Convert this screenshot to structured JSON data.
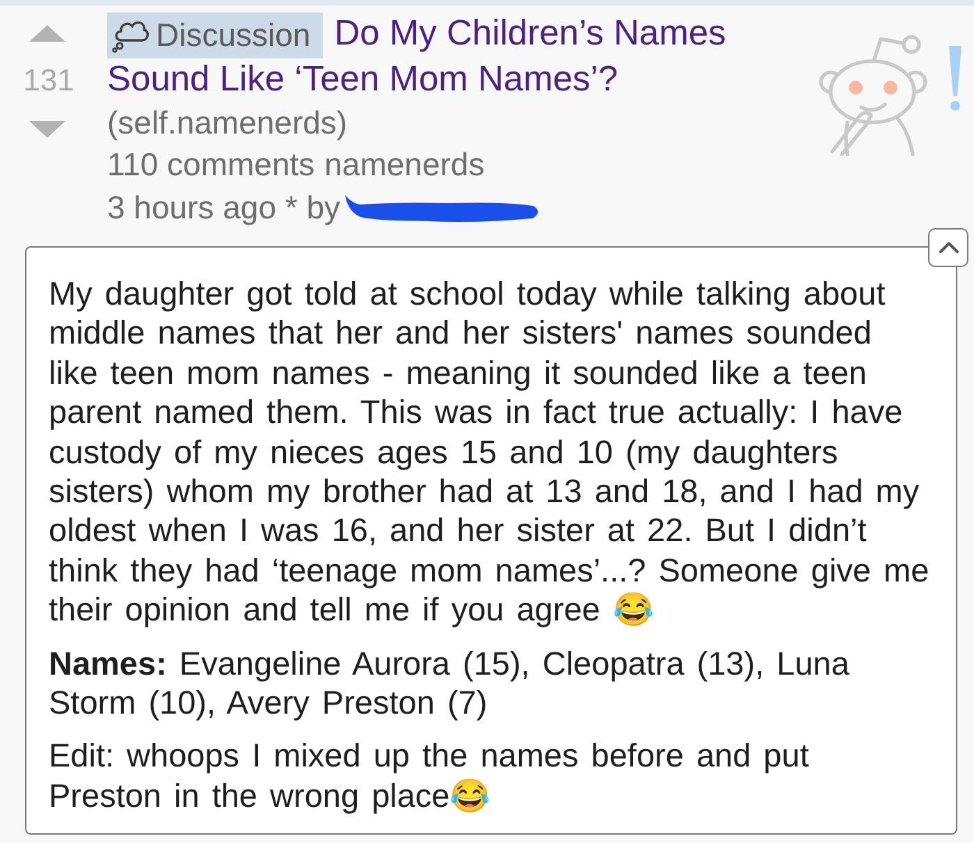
{
  "post": {
    "score": "131",
    "upvoted": false,
    "downvoted": false,
    "flair": {
      "label": "Discussion"
    },
    "title": "Do My Children’s Names Sound Like ‘Teen Mom Names’?",
    "domain": "(self.namenerds)",
    "comments": "110 comments",
    "subreddit": "namenerds",
    "byline": "3 hours ago * by"
  },
  "body": {
    "expanded": true,
    "paragraphs": [
      "My daughter got told at school today while talking about middle names that her and her sisters' names sounded like teen mom names - meaning it sounded like a teen parent named them. This was in fact true actually: I have custody of my nieces ages 15 and 10 (my daughters sisters) whom my brother had at 13 and 18, and I had my oldest when I was 16, and her sister at 22. But I didn’t think they had ‘teenage mom names’...? Someone give me their opinion and tell me if you agree 😂",
      "**Names:** Evangeline Aurora (15), Cleopatra (13), Luna Storm (10), Avery Preston (7)",
      "Edit: whoops I mixed up the names before and put Preston in the wrong place😂"
    ]
  }
}
